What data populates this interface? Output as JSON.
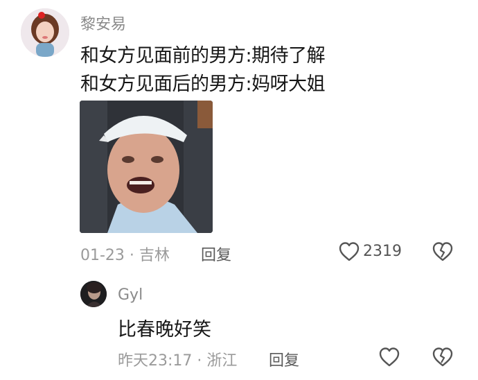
{
  "main_comment": {
    "username": "黎安易",
    "lines": [
      "和女方见面前的男方:期待了解",
      "和女方见面后的男方:妈呀大姐"
    ],
    "time": "01-23",
    "separator": " · ",
    "location": "吉林",
    "reply_label": "回复",
    "like_count": "2319",
    "image_alt": "man in white cap meme photo"
  },
  "reply_comment": {
    "username": "Gyl",
    "text": "比春晚好笑",
    "time": "昨天23:17",
    "separator": " · ",
    "location": "浙江",
    "reply_label": "回复"
  },
  "icons": {
    "like": "heart-outline-icon",
    "dislike": "broken-heart-icon"
  },
  "colors": {
    "text_primary": "#161616",
    "text_secondary": "#9a9a9a",
    "username": "#8a8a8a"
  }
}
